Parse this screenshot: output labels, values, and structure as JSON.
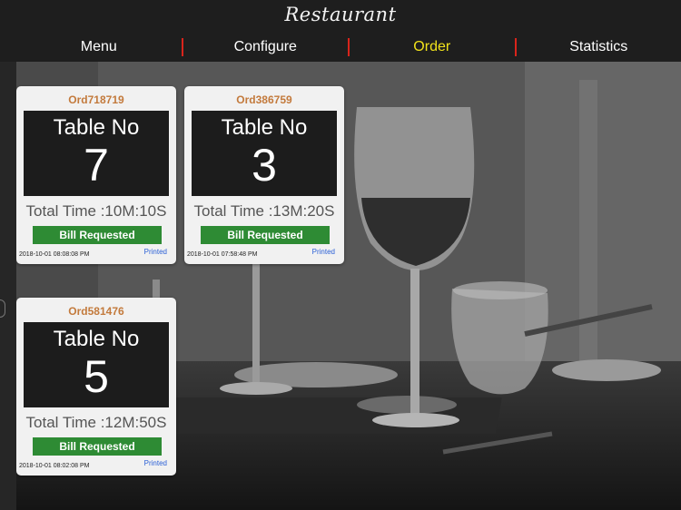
{
  "app": {
    "title": "Restaurant"
  },
  "nav": {
    "tabs": [
      {
        "label": "Menu"
      },
      {
        "label": "Configure"
      },
      {
        "label": "Order"
      },
      {
        "label": "Statistics"
      }
    ],
    "active_tab": "Order"
  },
  "orders": [
    {
      "order_id": "Ord718719",
      "table_label": "Table No",
      "table_number": "7",
      "total_time": "Total Time :10M:10S",
      "action_label": "Bill Requested",
      "timestamp": "2018-10-01 08:08:08 PM",
      "status": "Printed"
    },
    {
      "order_id": "Ord386759",
      "table_label": "Table No",
      "table_number": "3",
      "total_time": "Total Time :13M:20S",
      "action_label": "Bill Requested",
      "timestamp": "2018-10-01 07:58:48 PM",
      "status": "Printed"
    },
    {
      "order_id": "Ord581476",
      "table_label": "Table No",
      "table_number": "5",
      "total_time": "Total Time :12M:50S",
      "action_label": "Bill Requested",
      "timestamp": "2018-10-01 08:02:08 PM",
      "status": "Printed"
    }
  ],
  "colors": {
    "active_tab": "#f1e21b",
    "accent": "#d9241b",
    "order_id": "#c37a3c",
    "bill_button": "#2e8b34",
    "status": "#2a5fd6"
  }
}
